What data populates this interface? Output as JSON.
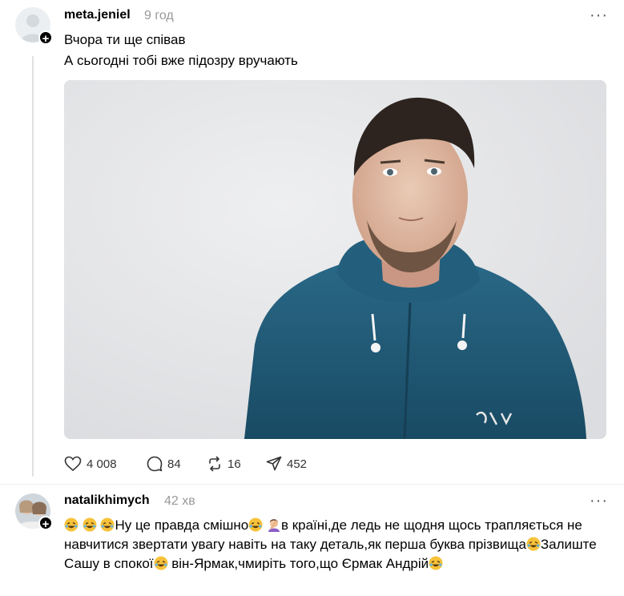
{
  "post": {
    "username": "meta.jeniel",
    "time": "9 год",
    "lines": [
      "Вчора ти ще співав",
      "А сьогодні тобі вже підозру вручають"
    ],
    "actions": {
      "likes": "4 008",
      "comments": "84",
      "reposts": "16",
      "shares": "452"
    }
  },
  "reply": {
    "username": "natalikhimych",
    "time": "42 хв",
    "segments": {
      "s1": "Ну це правда смішно",
      "s2": "в країні,де ледь не щодня щось трапляється не навчитися звертати увагу навіть на таку деталь,як перша буква прізвища",
      "s3": "Залиште Сашу в спокої",
      "s4": " він-Ярмак,чмиріть того,що Єрмак Андрій"
    }
  },
  "colors": {
    "muted": "#999999",
    "thread_line": "#e1e1e1",
    "jacket": "#1f5672",
    "photo_bg": "#e7e8ea"
  },
  "icons": [
    "plus-icon",
    "more-icon",
    "heart-icon",
    "comment-icon",
    "repost-icon",
    "share-icon",
    "rofl-emoji",
    "facepalm-emoji"
  ]
}
